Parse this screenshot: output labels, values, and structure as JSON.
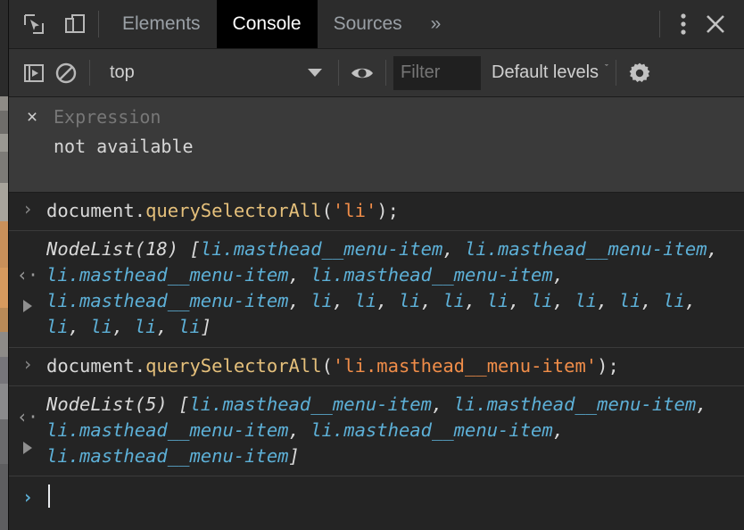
{
  "window": {
    "title": "Chrome DevTools Console"
  },
  "tabbar": {
    "inspect_icon": "inspect-element-icon",
    "device_icon": "device-toolbar-icon",
    "tabs": [
      {
        "label": "Elements",
        "selected": false
      },
      {
        "label": "Console",
        "selected": true
      },
      {
        "label": "Sources",
        "selected": false
      }
    ],
    "overflow_label": "»",
    "kebab_icon": "more-options-icon",
    "close_icon": "close-icon"
  },
  "filterbar": {
    "sidebar_toggle_icon": "console-sidebar-icon",
    "clear_icon": "clear-console-icon",
    "context": "top",
    "context_caret": "chevron-down-icon",
    "eye_icon": "create-live-expression-icon",
    "filter_placeholder": "Filter",
    "filter_value": "",
    "levels_label": "Default levels",
    "levels_caret": "ˇ",
    "settings_icon": "settings-gear-icon"
  },
  "live_expression": {
    "close_label": "×",
    "placeholder": "Expression",
    "value": "not available"
  },
  "console": {
    "input_marker": "›",
    "output_marker": "‹·",
    "entries": [
      {
        "type": "input",
        "segments": [
          {
            "text": "document.",
            "cls": "tok-plain"
          },
          {
            "text": "querySelectorAll",
            "cls": "tok-fn"
          },
          {
            "text": "(",
            "cls": "tok-plain"
          },
          {
            "text": "'li'",
            "cls": "tok-str"
          },
          {
            "text": ");",
            "cls": "tok-plain"
          }
        ]
      },
      {
        "type": "output",
        "expandable": true,
        "segments": [
          {
            "text": "NodeList(18) [",
            "cls": "tok-plain"
          },
          {
            "text": "li.masthead__menu-item",
            "cls": "tok-node"
          },
          {
            "text": ", ",
            "cls": "tok-plain"
          },
          {
            "text": "li.masthead__menu-item",
            "cls": "tok-node"
          },
          {
            "text": ", ",
            "cls": "tok-plain"
          },
          {
            "text": "li.masthead__menu-item",
            "cls": "tok-node"
          },
          {
            "text": ", ",
            "cls": "tok-plain"
          },
          {
            "text": "li.masthead__menu-item",
            "cls": "tok-node"
          },
          {
            "text": ", ",
            "cls": "tok-plain"
          },
          {
            "text": "li.masthead__menu-item",
            "cls": "tok-node"
          },
          {
            "text": ", ",
            "cls": "tok-plain"
          },
          {
            "text": "li",
            "cls": "tok-node"
          },
          {
            "text": ", ",
            "cls": "tok-plain"
          },
          {
            "text": "li",
            "cls": "tok-node"
          },
          {
            "text": ", ",
            "cls": "tok-plain"
          },
          {
            "text": "li",
            "cls": "tok-node"
          },
          {
            "text": ", ",
            "cls": "tok-plain"
          },
          {
            "text": "li",
            "cls": "tok-node"
          },
          {
            "text": ", ",
            "cls": "tok-plain"
          },
          {
            "text": "li",
            "cls": "tok-node"
          },
          {
            "text": ", ",
            "cls": "tok-plain"
          },
          {
            "text": "li",
            "cls": "tok-node"
          },
          {
            "text": ", ",
            "cls": "tok-plain"
          },
          {
            "text": "li",
            "cls": "tok-node"
          },
          {
            "text": ", ",
            "cls": "tok-plain"
          },
          {
            "text": "li",
            "cls": "tok-node"
          },
          {
            "text": ", ",
            "cls": "tok-plain"
          },
          {
            "text": "li",
            "cls": "tok-node"
          },
          {
            "text": ", ",
            "cls": "tok-plain"
          },
          {
            "text": "li",
            "cls": "tok-node"
          },
          {
            "text": ", ",
            "cls": "tok-plain"
          },
          {
            "text": "li",
            "cls": "tok-node"
          },
          {
            "text": ", ",
            "cls": "tok-plain"
          },
          {
            "text": "li",
            "cls": "tok-node"
          },
          {
            "text": ", ",
            "cls": "tok-plain"
          },
          {
            "text": "li",
            "cls": "tok-node"
          },
          {
            "text": "]",
            "cls": "tok-plain"
          }
        ]
      },
      {
        "type": "input",
        "segments": [
          {
            "text": "document.",
            "cls": "tok-plain"
          },
          {
            "text": "querySelectorAll",
            "cls": "tok-fn"
          },
          {
            "text": "(",
            "cls": "tok-plain"
          },
          {
            "text": "'li.masthead__menu-item'",
            "cls": "tok-str"
          },
          {
            "text": ");",
            "cls": "tok-plain"
          }
        ]
      },
      {
        "type": "output",
        "expandable": true,
        "segments": [
          {
            "text": "NodeList(5) [",
            "cls": "tok-plain"
          },
          {
            "text": "li.masthead__menu-item",
            "cls": "tok-node"
          },
          {
            "text": ", ",
            "cls": "tok-plain"
          },
          {
            "text": "li.masthead__menu-item",
            "cls": "tok-node"
          },
          {
            "text": ", ",
            "cls": "tok-plain"
          },
          {
            "text": "li.masthead__menu-item",
            "cls": "tok-node"
          },
          {
            "text": ", ",
            "cls": "tok-plain"
          },
          {
            "text": "li.masthead__menu-item",
            "cls": "tok-node"
          },
          {
            "text": ", ",
            "cls": "tok-plain"
          },
          {
            "text": "li.masthead__menu-item",
            "cls": "tok-node"
          },
          {
            "text": "]",
            "cls": "tok-plain"
          }
        ]
      }
    ],
    "prompt_marker": "›",
    "prompt_value": ""
  },
  "colors": {
    "tabbar_bg": "#2c2c2c",
    "filterbar_bg": "#333333",
    "console_bg": "#242424",
    "selected_tab_bg": "#000000",
    "node_blue": "#5db0d7",
    "string_orange": "#f08d49",
    "function_yellow": "#e5c07b"
  }
}
